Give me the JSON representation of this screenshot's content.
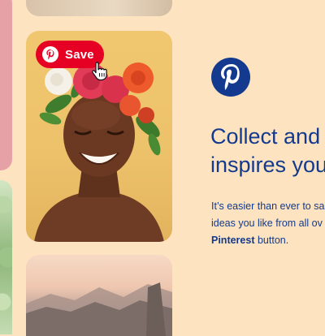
{
  "save_button": {
    "label": "Save",
    "color": "#e60023"
  },
  "promo": {
    "heading_line1": "Collect and",
    "heading_line2": "inspires you",
    "body_line1": "It’s easier than ever to sa",
    "body_line2": "ideas you like from all ov",
    "body_line3_bold": "Pinterest",
    "body_line3_rest": " button."
  },
  "colors": {
    "background": "#fde3bf",
    "text_primary": "#133a8e",
    "brand_red": "#e60023",
    "logo_blue": "#133a8e"
  },
  "icons": {
    "save_button_icon": "pinterest-logo-icon",
    "cursor": "hand-pointer-cursor-icon",
    "brand_logo": "pinterest-logo-icon"
  }
}
